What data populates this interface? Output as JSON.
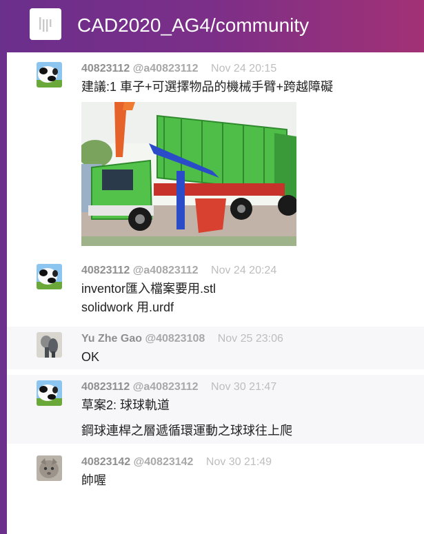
{
  "room": {
    "title": "CAD2020_AG4/community",
    "icon": "gitter-icon"
  },
  "messages": [
    {
      "name": "40823112",
      "username": "@a40823112",
      "time": "Nov 24 20:15",
      "lines": [
        "建議:1 車子+可選擇物品的機械手臂+跨越障礙"
      ],
      "has_image": true
    },
    {
      "name": "40823112",
      "username": "@a40823112",
      "time": "Nov 24 20:24",
      "lines": [
        "inventor匯入檔案要用.stl",
        "solidwork 用.urdf"
      ]
    },
    {
      "name": "Yu Zhe Gao",
      "username": "@40823108",
      "time": "Nov 25 23:06",
      "lines": [
        "OK"
      ]
    },
    {
      "name": "40823112",
      "username": "@a40823112",
      "time": "Nov 30 21:47",
      "lines": [
        "草案2: 球球軌道",
        "鋼球連桿之層遞循環運動之球球往上爬"
      ]
    },
    {
      "name": "40823142",
      "username": "@40823142",
      "time": "Nov 30 21:49",
      "lines": [
        "帥喔"
      ]
    }
  ]
}
